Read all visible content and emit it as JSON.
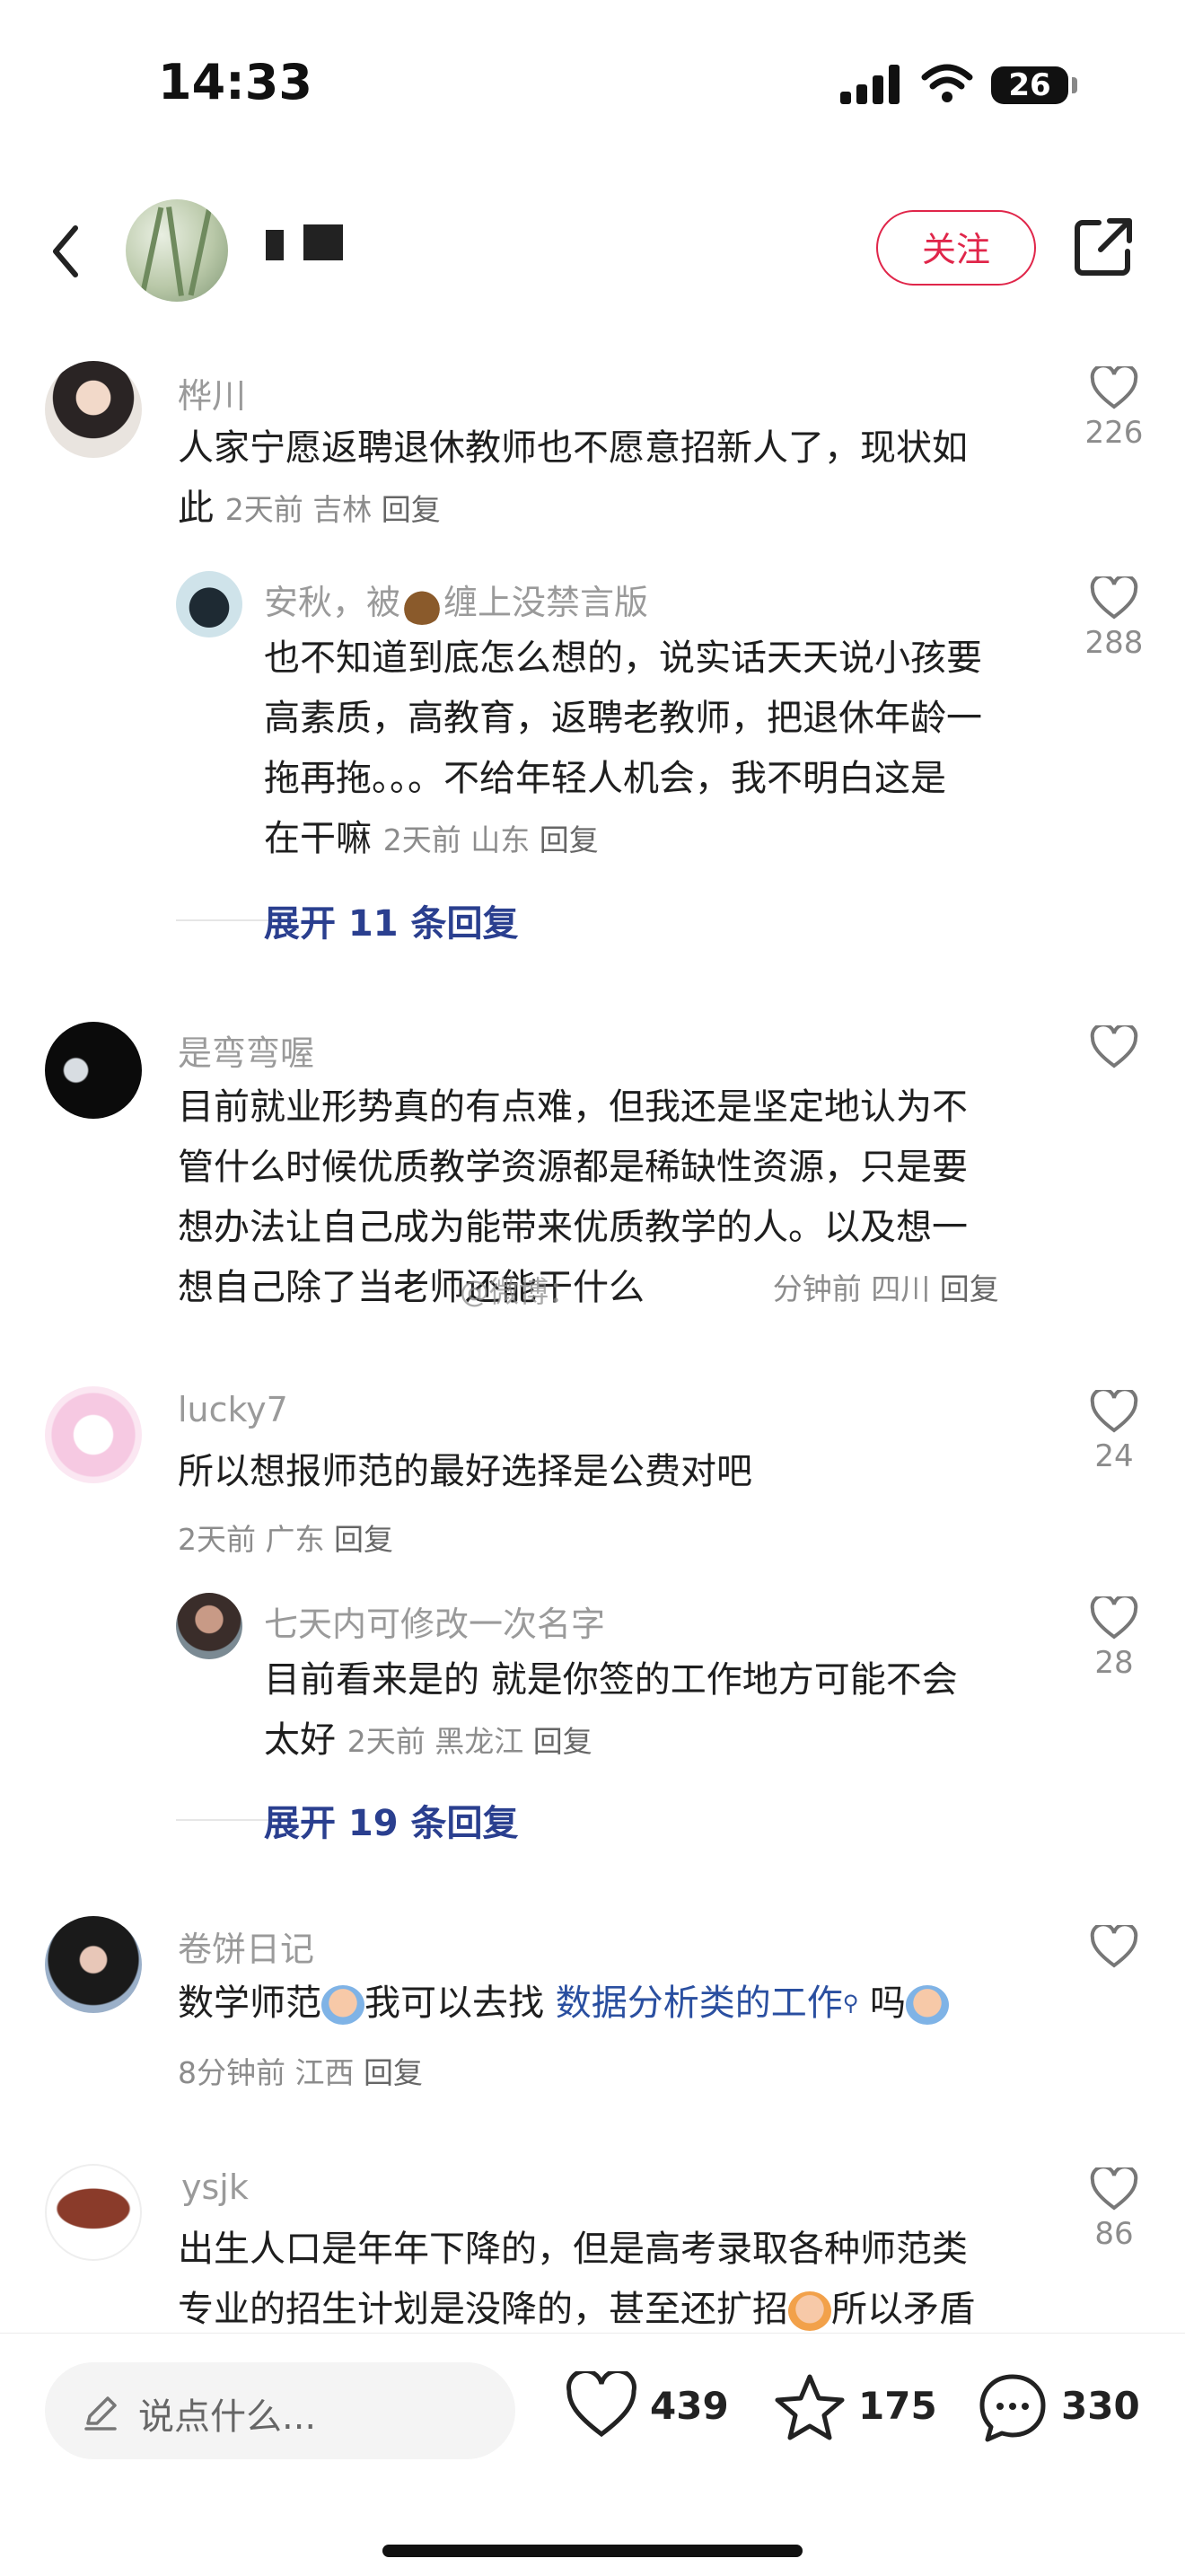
{
  "status_bar": {
    "time": "14:33",
    "battery": "26"
  },
  "header": {
    "follow_label": "关注"
  },
  "comments": [
    {
      "user": "桦川",
      "text_lines": [
        "人家宁愿返聘退休教师也不愿意招新人了，现状如",
        "此"
      ],
      "time": "2天前",
      "location": "吉林",
      "reply": "回复",
      "likes": "226"
    },
    {
      "user": "安秋，被",
      "user_suffix": "缠上没禁言版",
      "text_lines": [
        "也不知道到底怎么想的，说实话天天说小孩要",
        "高素质，高教育，返聘老教师，把退休年龄一",
        "拖再拖。。。不给年轻人机会，我不明白这是",
        "在干嘛"
      ],
      "time": "2天前",
      "location": "山东",
      "reply": "回复",
      "likes": "288"
    },
    {
      "user": "是弯弯喔",
      "text_lines": [
        "目前就业形势真的有点难，但我还是坚定地认为不",
        "管什么时候优质教学资源都是稀缺性资源，只是要",
        "想办法让自己成为能带来优质教学的人。以及想一",
        "想自己除了当老师还能干什么"
      ],
      "time": "分钟前",
      "location": "四川",
      "reply": "回复",
      "likes": ""
    },
    {
      "user": "lucky7",
      "text_lines": [
        "所以想报师范的最好选择是公费对吧"
      ],
      "time": "2天前",
      "location": "广东",
      "reply": "回复",
      "likes": "24"
    },
    {
      "user": "七天内可修改一次名字",
      "text_lines": [
        "目前看来是的 就是你签的工作地方可能不会",
        "太好"
      ],
      "time": "2天前",
      "location": "黑龙江",
      "reply": "回复",
      "likes": "28"
    },
    {
      "user": "卷饼日记",
      "text_prefix": "数学师范",
      "text_mid": "我可以去找",
      "link_text": "数据分析类的工作",
      "text_suffix": "吗",
      "time": "8分钟前",
      "location": "江西",
      "reply": "回复",
      "likes": ""
    },
    {
      "user": "ysjk",
      "text_lines": [
        "出生人口是年年下降的，但是高考录取各种师范类",
        "专业的招生计划是没降的，甚至还扩招"
      ],
      "text_tail": "所以矛盾",
      "likes": "86"
    }
  ],
  "expand": [
    "展开 11 条回复",
    "展开 19 条回复"
  ],
  "watermark": "@微博：",
  "bottom_bar": {
    "placeholder": "说点什么...",
    "likes": "439",
    "stars": "175",
    "comments": "330"
  },
  "icons": [
    "back-icon",
    "share-icon",
    "heart-icon",
    "star-icon",
    "chat-icon",
    "pen-icon",
    "wifi-icon",
    "signal-icon"
  ],
  "colors": {
    "accent": "#e0264a",
    "link": "#2a4fa0",
    "expand": "#2a3f8f"
  }
}
